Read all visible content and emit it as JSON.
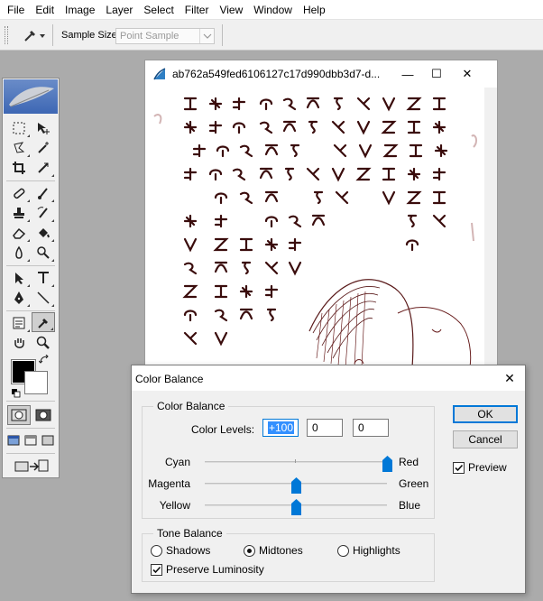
{
  "menu": [
    "File",
    "Edit",
    "Image",
    "Layer",
    "Select",
    "Filter",
    "View",
    "Window",
    "Help"
  ],
  "options": {
    "sample_size_label": "Sample Size:",
    "sample_size_value": "Point Sample"
  },
  "document": {
    "title": "ab762a549fed6106127c17d990dbb3d7-d...",
    "minimize": "—",
    "maximize": "☐",
    "close": "✕"
  },
  "dialog": {
    "title": "Color Balance",
    "close": "✕",
    "color_balance_group": "Color Balance",
    "color_levels_label": "Color Levels:",
    "levels": [
      "+100",
      "0",
      "0"
    ],
    "sliders": [
      {
        "left": "Cyan",
        "right": "Red",
        "value": 100
      },
      {
        "left": "Magenta",
        "right": "Green",
        "value": 0
      },
      {
        "left": "Yellow",
        "right": "Blue",
        "value": 0
      }
    ],
    "tone_balance_group": "Tone Balance",
    "tones": [
      {
        "label": "Shadows",
        "selected": false
      },
      {
        "label": "Midtones",
        "selected": true
      },
      {
        "label": "Highlights",
        "selected": false
      }
    ],
    "preserve_luminosity": {
      "label": "Preserve Luminosity",
      "checked": true
    },
    "ok_label": "OK",
    "cancel_label": "Cancel",
    "preview": {
      "label": "Preview",
      "checked": true
    }
  },
  "colors": {
    "accent": "#0078d7",
    "glyph_ink": "#3a0c0c"
  }
}
